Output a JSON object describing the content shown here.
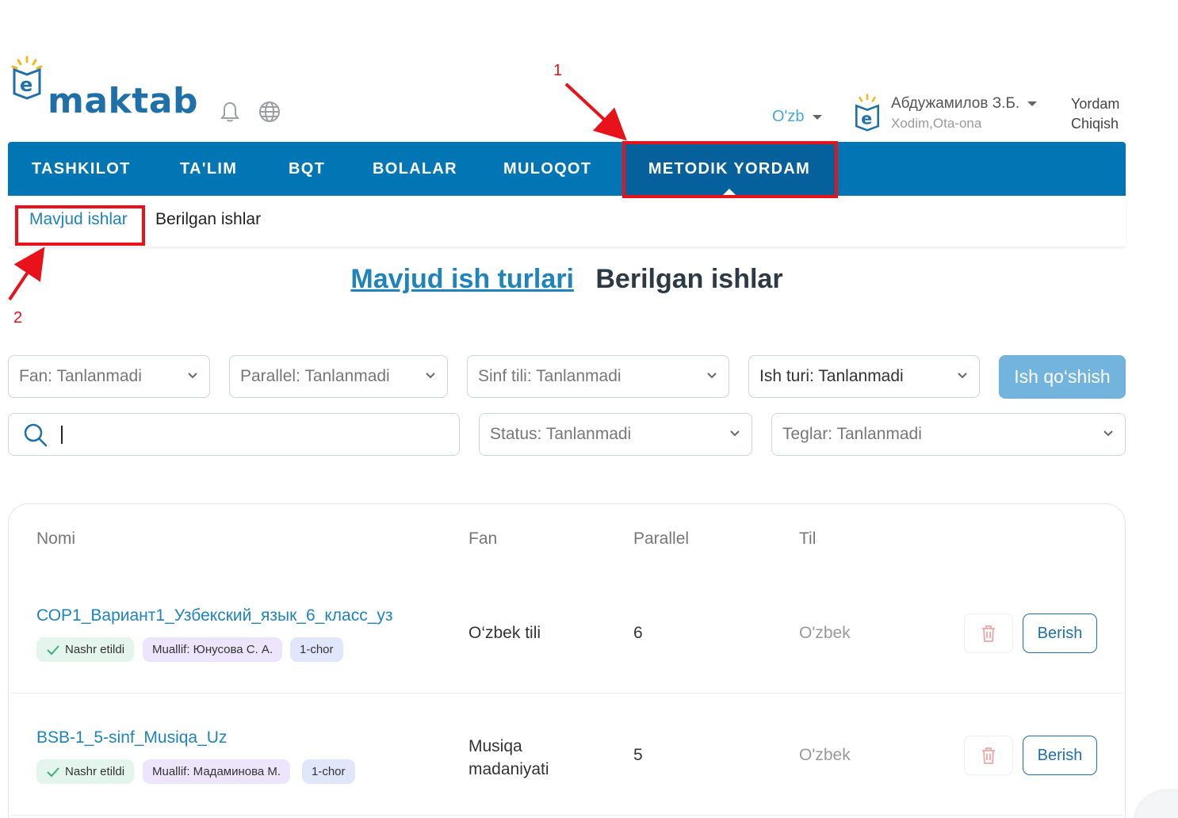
{
  "brand": {
    "name": "maktab"
  },
  "header": {
    "language": "O'zb",
    "user_name": "Абдужамилов З.Б.",
    "user_role": "Xodim,Ota-ona",
    "help": "Yordam",
    "logout": "Chiqish"
  },
  "nav": {
    "items": [
      {
        "label": "TASHKILOT"
      },
      {
        "label": "TA'LIM"
      },
      {
        "label": "BQT"
      },
      {
        "label": "BOLALAR"
      },
      {
        "label": "MULOQOT"
      },
      {
        "label": "METODIK YORDAM",
        "active": true
      }
    ]
  },
  "subnav": {
    "items": [
      {
        "label": "Mavjud ishlar",
        "active": true
      },
      {
        "label": "Berilgan ishlar"
      }
    ]
  },
  "annotations": {
    "one": "1",
    "two": "2"
  },
  "page": {
    "title_link": "Mavjud ish turlari",
    "title": "Berilgan ishlar"
  },
  "filters": {
    "fan": "Fan: Tanlanmadi",
    "parallel": "Parallel: Tanlanmadi",
    "sinf_tili": "Sinf tili: Tanlanmadi",
    "ish_turi": "Ish turi: Tanlanmadi",
    "add_button": "Ish qo‘shish",
    "search_value": "",
    "status": "Status: Tanlanmadi",
    "teglar": "Teglar: Tanlanmadi"
  },
  "table": {
    "columns": [
      "Nomi",
      "Fan",
      "Parallel",
      "Til"
    ],
    "rows": [
      {
        "title": "СОР1_Вариант1_Узбекский_язык_6_класс_уз",
        "status": "Nashr etildi",
        "author": "Muallif: Юнусова С. А.",
        "quarter": "1-chor",
        "fan": "O‘zbek tili",
        "parallel": "6",
        "til": "O'zbek",
        "action": "Berish"
      },
      {
        "title": "BSB-1_5-sinf_Musiqa_Uz",
        "status": "Nashr etildi",
        "author": "Muallif: Мадаминова М.",
        "quarter": "1-chor",
        "fan_line1": "Musiqa",
        "fan_line2": "madaniyati",
        "parallel": "5",
        "til": "O'zbek",
        "action": "Berish"
      }
    ]
  },
  "colors": {
    "primary": "#0276b5",
    "active_nav": "#05609b",
    "annotation": "#e8121b",
    "link": "#1f83bc"
  }
}
